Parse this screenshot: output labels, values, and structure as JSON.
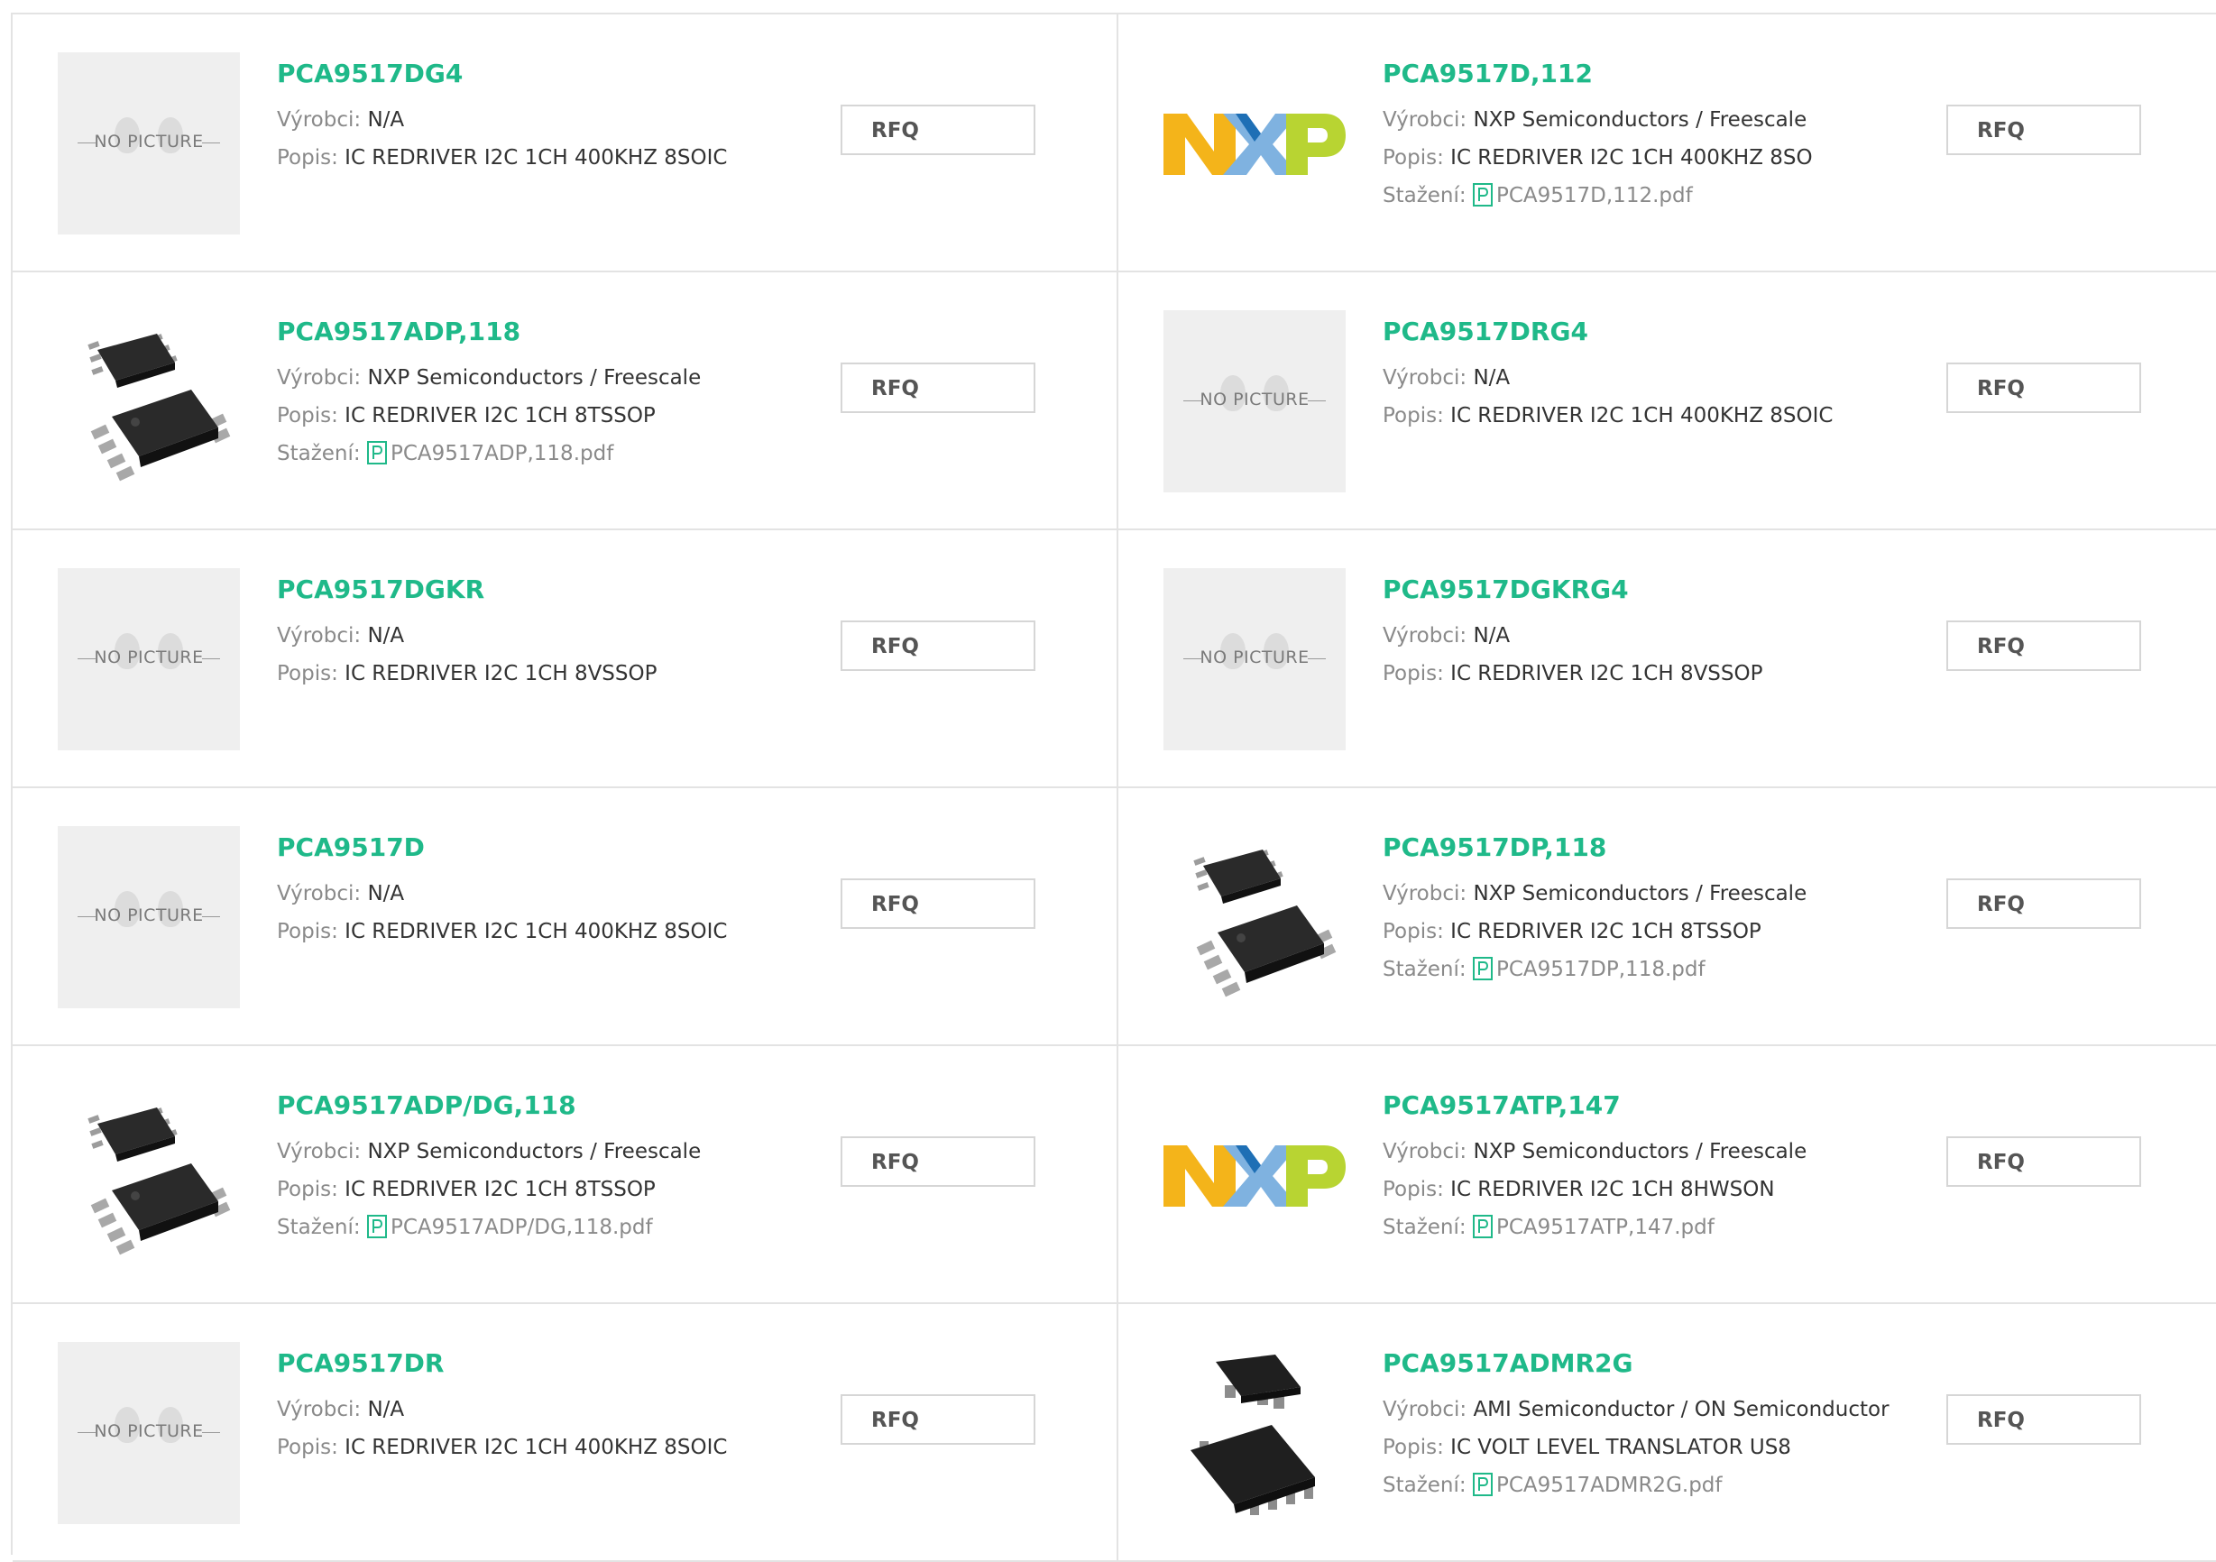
{
  "labels": {
    "manufacturer": "Výrobci:",
    "description": "Popis:",
    "download": "Stažení:",
    "rfq": "RFQ",
    "no_picture": "NO PICTURE"
  },
  "colors": {
    "title_green": "#1fb989",
    "border": "#e3e3e3",
    "label_gray": "#8a8a8a"
  },
  "products": [
    {
      "part": "PCA9517DG4",
      "manufacturer": "N/A",
      "description": "IC REDRIVER I2C 1CH 400KHZ 8SOIC",
      "image": "no-picture",
      "pdf": null
    },
    {
      "part": "PCA9517D,112",
      "manufacturer": "NXP Semiconductors / Freescale",
      "description": "IC REDRIVER I2C 1CH 400KHZ 8SO",
      "image": "nxp-logo",
      "pdf": "PCA9517D,112.pdf"
    },
    {
      "part": "PCA9517ADP,118",
      "manufacturer": "NXP Semiconductors / Freescale",
      "description": "IC REDRIVER I2C 1CH 8TSSOP",
      "image": "chip-tssop",
      "pdf": "PCA9517ADP,118.pdf"
    },
    {
      "part": "PCA9517DRG4",
      "manufacturer": "N/A",
      "description": "IC REDRIVER I2C 1CH 400KHZ 8SOIC",
      "image": "no-picture",
      "pdf": null
    },
    {
      "part": "PCA9517DGKR",
      "manufacturer": "N/A",
      "description": "IC REDRIVER I2C 1CH 8VSSOP",
      "image": "no-picture",
      "pdf": null
    },
    {
      "part": "PCA9517DGKRG4",
      "manufacturer": "N/A",
      "description": "IC REDRIVER I2C 1CH 8VSSOP",
      "image": "no-picture",
      "pdf": null
    },
    {
      "part": "PCA9517D",
      "manufacturer": "N/A",
      "description": "IC REDRIVER I2C 1CH 400KHZ 8SOIC",
      "image": "no-picture",
      "pdf": null
    },
    {
      "part": "PCA9517DP,118",
      "manufacturer": "NXP Semiconductors / Freescale",
      "description": "IC REDRIVER I2C 1CH 8TSSOP",
      "image": "chip-tssop",
      "pdf": "PCA9517DP,118.pdf"
    },
    {
      "part": "PCA9517ADP/DG,118",
      "manufacturer": "NXP Semiconductors / Freescale",
      "description": "IC REDRIVER I2C 1CH 8TSSOP",
      "image": "chip-tssop",
      "pdf": "PCA9517ADP/DG,118.pdf"
    },
    {
      "part": "PCA9517ATP,147",
      "manufacturer": "NXP Semiconductors / Freescale",
      "description": "IC REDRIVER I2C 1CH 8HWSON",
      "image": "nxp-logo",
      "pdf": "PCA9517ATP,147.pdf"
    },
    {
      "part": "PCA9517DR",
      "manufacturer": "N/A",
      "description": "IC REDRIVER I2C 1CH 400KHZ 8SOIC",
      "image": "no-picture",
      "pdf": null
    },
    {
      "part": "PCA9517ADMR2G",
      "manufacturer": "AMI Semiconductor / ON Semiconductor",
      "description": "IC VOLT LEVEL TRANSLATOR US8",
      "image": "chip-us8",
      "pdf": "PCA9517ADMR2G.pdf"
    }
  ]
}
